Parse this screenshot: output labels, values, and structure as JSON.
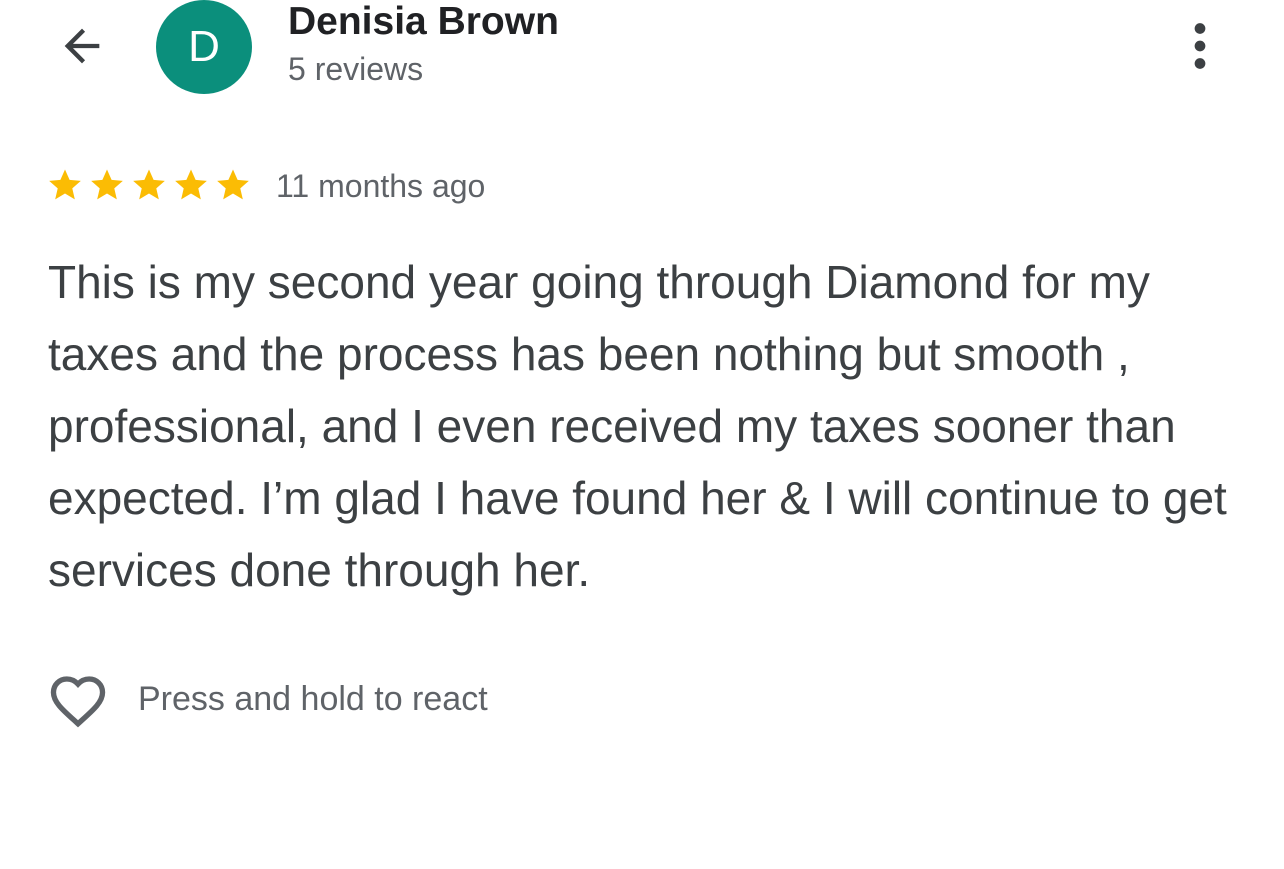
{
  "header": {
    "back_icon": "arrow-left-icon",
    "avatar_letter": "D",
    "avatar_color": "#0b8f7c",
    "reviewer_name": "Denisia Brown",
    "review_count": "5 reviews",
    "more_icon": "more-vertical-icon"
  },
  "review": {
    "rating": 5,
    "rating_max": 5,
    "star_color": "#fbbc04",
    "time_ago": "11 months ago",
    "text": "This is my second year going through Diamond for my taxes and the process has been nothing but smooth , professional, and I even received my taxes sooner than expected. I’m glad I have found her & I will continue to get services done through her."
  },
  "reaction": {
    "icon": "heart-outline-icon",
    "hint": "Press and hold to react"
  }
}
